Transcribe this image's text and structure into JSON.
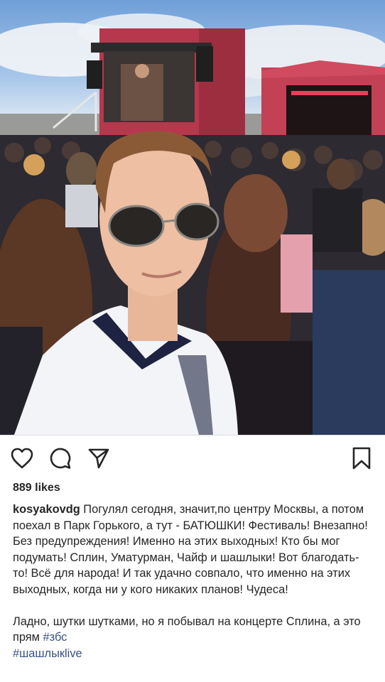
{
  "post": {
    "photo_description_icon": "image",
    "likes": "889 likes",
    "username": "kosyakovdg",
    "caption_main": " Погулял сегодня, значит,по центру Москвы, а потом поехал в Парк Горького, а тут - БАТЮШКИ! Фестиваль! Внезапно! Без предупреждения! Именно на этих выходных! Кто бы мог подумать! Сплин, Уматурман, Чайф и шашлыки! Вот благодать-то! Всё для народа! И так удачно совпало, что именно на этих выходных, когда ни у кого никаких планов! Чудеса!",
    "caption_second": "Ладно, шутки шутками, но я побывал на концерте Сплина, а это прям ",
    "hashtag_1": "#збс",
    "hashtag_2": "#шашлыкlive"
  },
  "actions": {
    "like_icon": "heart-icon",
    "comment_icon": "comment-icon",
    "share_icon": "share-icon",
    "save_icon": "bookmark-icon"
  },
  "colors": {
    "text": "#262626",
    "hashtag": "#385185",
    "background": "#ffffff"
  }
}
